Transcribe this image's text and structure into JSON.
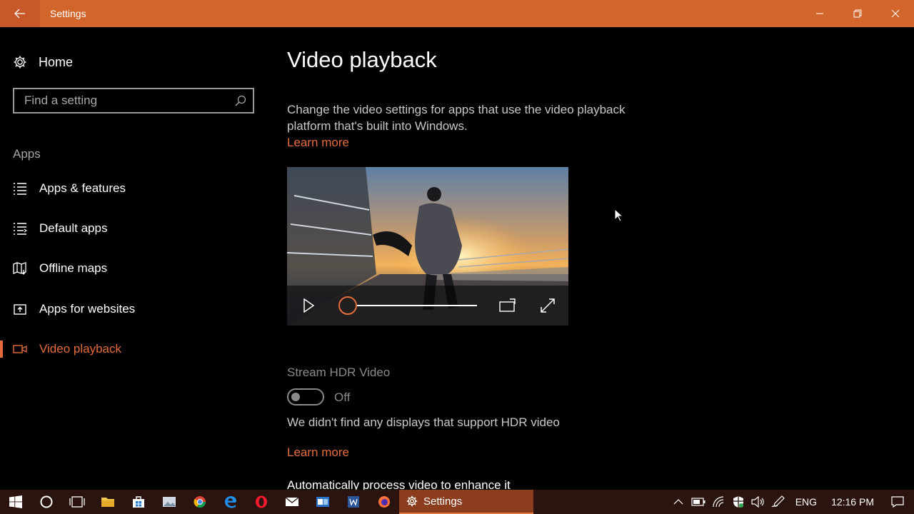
{
  "window": {
    "title": "Settings",
    "accent_color": "#d2652b",
    "link_color": "#e46c3d"
  },
  "sidebar": {
    "home_label": "Home",
    "search_placeholder": "Find a setting",
    "section_label": "Apps",
    "items": [
      {
        "label": "Apps & features",
        "icon": "list-icon",
        "active": false
      },
      {
        "label": "Default apps",
        "icon": "default-apps-icon",
        "active": false
      },
      {
        "label": "Offline maps",
        "icon": "map-icon",
        "active": false
      },
      {
        "label": "Apps for websites",
        "icon": "open-in-icon",
        "active": false
      },
      {
        "label": "Video playback",
        "icon": "video-camera-icon",
        "active": true
      }
    ]
  },
  "main": {
    "title": "Video playback",
    "description": "Change the video settings for apps that use the video playback platform that's built into Windows.",
    "learn_more_1": "Learn more",
    "video": {
      "progress": 0
    },
    "hdr": {
      "label": "Stream HDR Video",
      "toggle_state": "Off",
      "is_on": false,
      "message": "We didn't find any displays that support HDR video",
      "learn_more": "Learn more"
    },
    "auto_process_label": "Automatically process video to enhance it"
  },
  "taskbar": {
    "pinned_icons": [
      "start-icon",
      "cortana-icon",
      "task-view-icon",
      "file-explorer-icon",
      "store-icon",
      "photos-icon",
      "chrome-icon",
      "edge-icon",
      "opera-icon",
      "mail-icon",
      "outlook-icon",
      "word-icon",
      "firefox-icon"
    ],
    "active_app_label": "Settings",
    "language": "ENG",
    "time": "12:16 PM"
  }
}
